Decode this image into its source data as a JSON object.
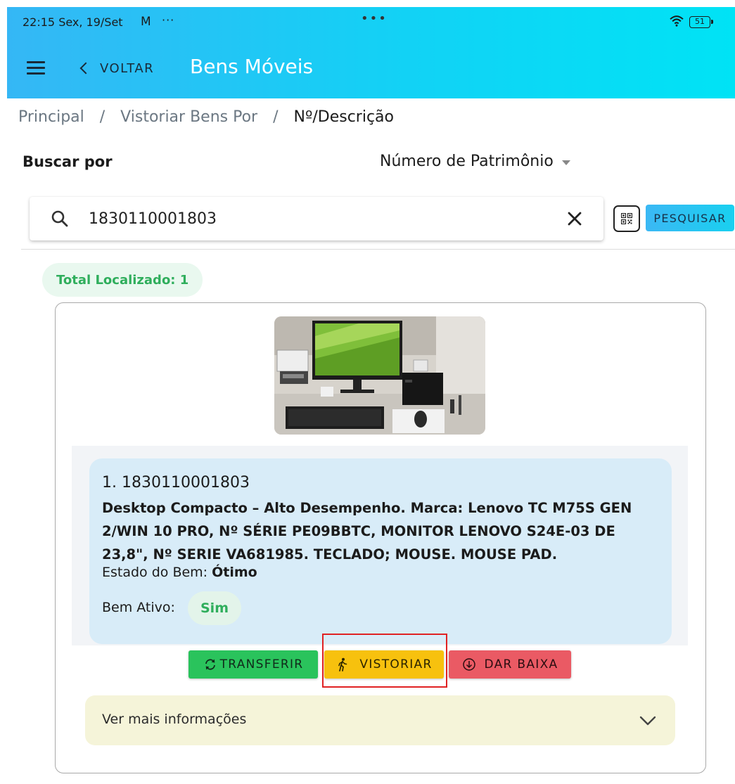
{
  "status_bar": {
    "time_date": "22:15  Sex, 19/Set",
    "mail_glyph": "M",
    "more_dots": "···",
    "center_dots": "•••",
    "battery": "51"
  },
  "app_bar": {
    "back_label": "VOLTAR",
    "title": "Bens Móveis"
  },
  "breadcrumb": {
    "items": [
      "Principal",
      "Vistoriar Bens Por",
      "Nº/Descrição"
    ],
    "separator": "/"
  },
  "search_by": {
    "label": "Buscar por",
    "selected": "Número de Patrimônio"
  },
  "search": {
    "value": "1830110001803",
    "button_label": "PESQUISAR"
  },
  "results": {
    "total_label": "Total Localizado: 1",
    "items": [
      {
        "number_line": "1. 1830110001803",
        "description": "Desktop Compacto – Alto Desempenho. Marca: Lenovo TC M75S GEN 2/WIN 10 PRO, Nº SÉRIE PE09BBTC, MONITOR LENOVO S24E-03 DE 23,8\", Nº SERIE VA681985. TECLADO; MOUSE. MOUSE PAD.",
        "state_label": "Estado do Bem:",
        "state_value": "Ótimo",
        "active_label": "Bem Ativo:",
        "active_value": "Sim"
      }
    ]
  },
  "actions": {
    "transfer": "TRANSFERIR",
    "inspect": "VISTORIAR",
    "write_off": "DAR BAIXA"
  },
  "more_info": {
    "label": "Ver mais informações"
  },
  "colors": {
    "header_start": "#35b7f5",
    "header_end": "#00e3f5",
    "transfer": "#2ac35c",
    "inspect": "#f7c10e",
    "write_off": "#ea5a64",
    "highlight": "#e02222",
    "info_card": "#d8ecf8",
    "more_info_bg": "#f5f4d9"
  },
  "icons": {
    "menu": "menu-icon",
    "back": "chevron-left-icon",
    "search": "search-icon",
    "clear": "close-icon",
    "qr": "qr-code-icon",
    "transfer": "sync-icon",
    "inspect": "walking-person-icon",
    "write_off": "arrow-down-circle-icon",
    "expand": "chevron-down-icon"
  }
}
